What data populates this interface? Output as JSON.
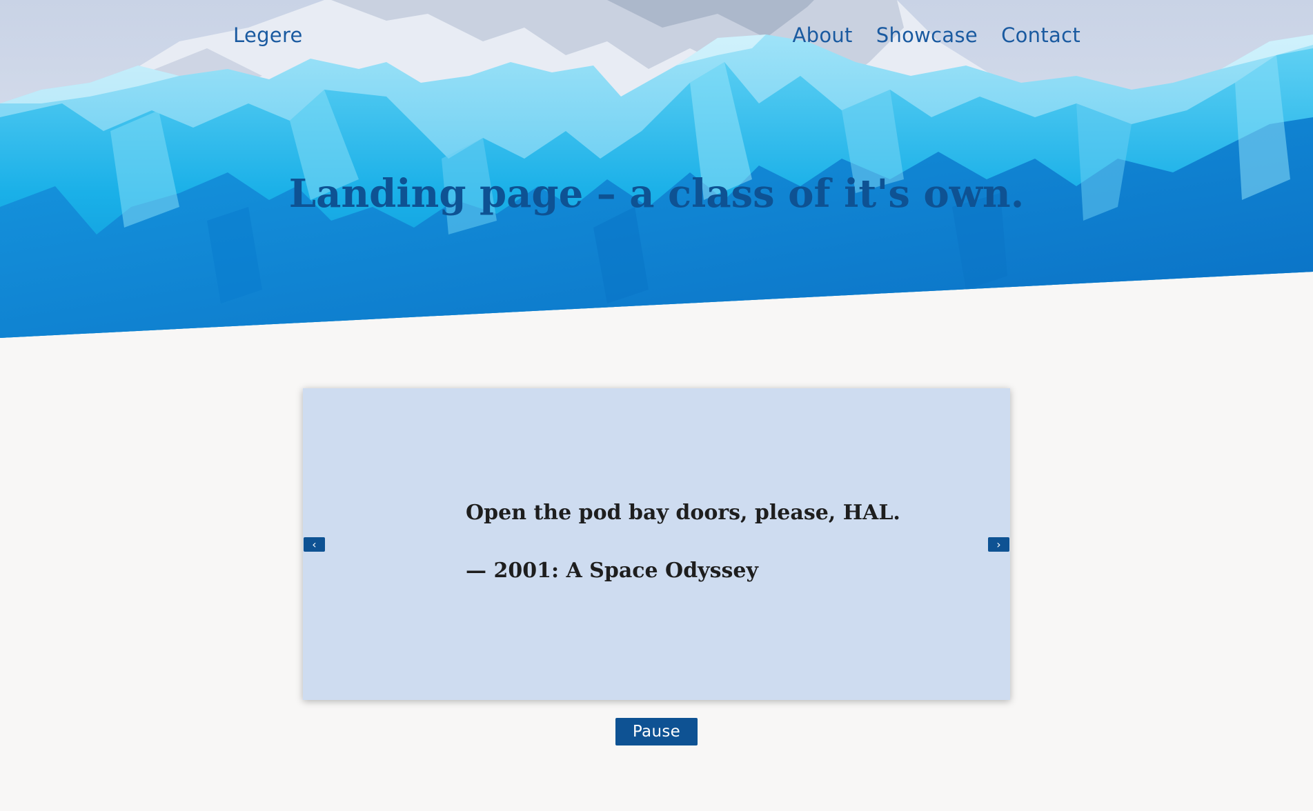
{
  "header": {
    "brand": "Legere",
    "nav": [
      {
        "label": "About"
      },
      {
        "label": "Showcase"
      },
      {
        "label": "Contact"
      }
    ],
    "headline": "Landing page – a class of it's own.",
    "background_image": "glacier-ice-photo"
  },
  "carousel": {
    "quote": "Open the pod bay doors, please, HAL.",
    "citation": "— 2001: A Space Odyssey",
    "prev_label": "‹",
    "next_label": "›",
    "pause_label": "Pause"
  },
  "colors": {
    "accent": "#0e5293",
    "nav_text": "#1a5aa0",
    "card_bg": "#cedcf0",
    "page_bg": "#f8f7f6",
    "quote_text": "#1e1e1e"
  }
}
